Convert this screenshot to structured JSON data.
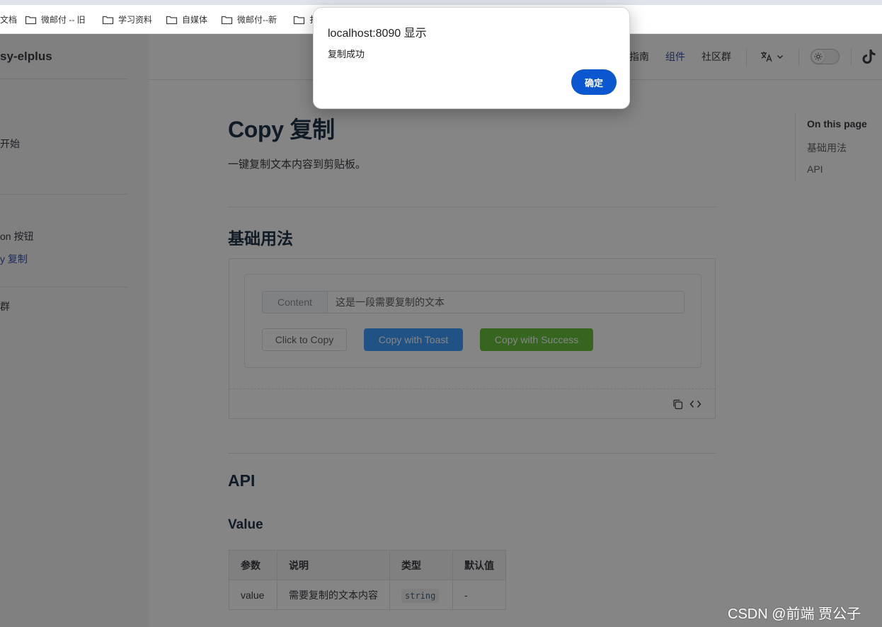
{
  "browser": {
    "bookmarks": [
      {
        "label": "文档",
        "icon": "none"
      },
      {
        "label": "微邮付 -- 旧",
        "icon": "folder-icon"
      },
      {
        "label": "学习资料",
        "icon": "folder-icon"
      },
      {
        "label": "自媒体",
        "icon": "folder-icon"
      },
      {
        "label": "微邮付--新",
        "icon": "folder-icon"
      },
      {
        "label": "扌",
        "icon": "folder-icon"
      }
    ]
  },
  "site": {
    "brand": "sy-elplus",
    "sidebar": {
      "items": [
        {
          "label": "开始",
          "active": false
        },
        {
          "label": "on 按钮",
          "active": false
        },
        {
          "label": "y 复制",
          "active": true
        },
        {
          "label": "群",
          "active": false
        }
      ]
    },
    "nav": {
      "links": [
        {
          "label": "指南",
          "active": false
        },
        {
          "label": "组件",
          "active": true
        },
        {
          "label": "社区群",
          "active": false
        }
      ],
      "lang_icon": "translate-icon",
      "theme_icon": "sun-icon",
      "social_icon": "tiktok-icon"
    }
  },
  "page": {
    "title": "Copy 复制",
    "lead": "一键复制文本内容到剪贴板。",
    "section_basic": "基础用法",
    "demo": {
      "prefix": "Content",
      "input_value": "这是一段需要复制的文本",
      "buttons": {
        "click": "Click to Copy",
        "toast": "Copy with Toast",
        "success": "Copy with Success"
      },
      "toolbar_icons": [
        "copy-icon",
        "code-icon"
      ]
    },
    "section_api": "API",
    "subsection_value": "Value",
    "table": {
      "headers": [
        "参数",
        "说明",
        "类型",
        "默认值"
      ],
      "row": {
        "param": "value",
        "desc": "需要复制的文本内容",
        "type": "string",
        "default": "-"
      }
    }
  },
  "toc": {
    "title": "On this page",
    "links": [
      "基础用法",
      "API"
    ]
  },
  "dialog": {
    "title": "localhost:8090 显示",
    "message": "复制成功",
    "ok": "确定"
  },
  "watermark": "CSDN @前端 贾公子",
  "colors": {
    "accent": "#3451b2",
    "primary_button": "#409eff",
    "success_button": "#67c23a",
    "dialog_button": "#0b57d0"
  }
}
